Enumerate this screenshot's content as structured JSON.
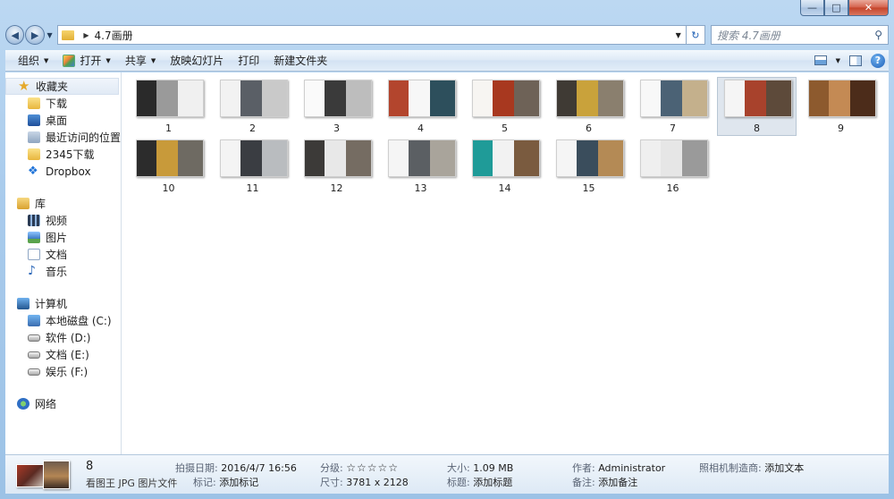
{
  "window": {
    "minimize_glyph": "—",
    "maximize_glyph": "□",
    "close_glyph": "✕"
  },
  "nav": {
    "back_glyph": "◀",
    "forward_glyph": "▶",
    "dropdown_glyph": "▼",
    "address_sep": "▶",
    "address_path": "4.7画册",
    "address_dropdown": "▼",
    "refresh_glyph": "↻",
    "search_placeholder": "搜索 4.7画册",
    "search_glyph": "⚲"
  },
  "toolbar": {
    "organize": "组织",
    "open": "打开",
    "share": "共享",
    "slideshow": "放映幻灯片",
    "print": "打印",
    "new_folder": "新建文件夹",
    "arrow": "▼",
    "help": "?"
  },
  "sidebar": {
    "favorites": {
      "head": "收藏夹",
      "items": [
        "下载",
        "桌面",
        "最近访问的位置",
        "2345下载",
        "Dropbox"
      ]
    },
    "libraries": {
      "head": "库",
      "items": [
        "视频",
        "图片",
        "文档",
        "音乐"
      ]
    },
    "computer": {
      "head": "计算机",
      "items": [
        "本地磁盘 (C:)",
        "软件 (D:)",
        "文档 (E:)",
        "娱乐 (F:)"
      ]
    },
    "network": {
      "head": "网络"
    },
    "icons": {
      "star": "★",
      "dropbox": "❖",
      "music": "♪"
    }
  },
  "files": {
    "items": [
      {
        "name": "1",
        "colors": [
          "#2a2a2a",
          "#9a9a9a",
          "#f0f0f0"
        ]
      },
      {
        "name": "2",
        "colors": [
          "#f2f2f2",
          "#5a5f66",
          "#c9c9c9"
        ]
      },
      {
        "name": "3",
        "colors": [
          "#fafafa",
          "#3a3a3a",
          "#bdbdbd"
        ]
      },
      {
        "name": "4",
        "colors": [
          "#b3452d",
          "#f7f7f7",
          "#2d4f5c"
        ]
      },
      {
        "name": "5",
        "colors": [
          "#f7f5f2",
          "#a8381f",
          "#6e6257"
        ]
      },
      {
        "name": "6",
        "colors": [
          "#3f3a34",
          "#c9a23b",
          "#8a7f6e"
        ]
      },
      {
        "name": "7",
        "colors": [
          "#f8f8f8",
          "#4b6275",
          "#c4b08c"
        ]
      },
      {
        "name": "8",
        "colors": [
          "#f5f5f5",
          "#a8422c",
          "#5d4a3a"
        ]
      },
      {
        "name": "9",
        "colors": [
          "#8d5a2e",
          "#c48a54",
          "#4c2c1a"
        ]
      },
      {
        "name": "10",
        "colors": [
          "#2c2c2c",
          "#c89a3a",
          "#6e6a62"
        ]
      },
      {
        "name": "11",
        "colors": [
          "#f4f4f4",
          "#3a3d42",
          "#b9bcbf"
        ]
      },
      {
        "name": "12",
        "colors": [
          "#3c3a38",
          "#e8e8e8",
          "#756c62"
        ]
      },
      {
        "name": "13",
        "colors": [
          "#f5f5f5",
          "#5b5f63",
          "#a9a49b"
        ]
      },
      {
        "name": "14",
        "colors": [
          "#1f9b98",
          "#f2f2f2",
          "#7a5b3f"
        ]
      },
      {
        "name": "15",
        "colors": [
          "#f5f5f5",
          "#3a4d5c",
          "#b48a55"
        ]
      },
      {
        "name": "16",
        "colors": [
          "#efefef",
          "#e6e6e6",
          "#9a9a9a"
        ]
      }
    ],
    "selected_index": 7
  },
  "details": {
    "name": "8",
    "type": "看图王 JPG 图片文件",
    "date_key": "拍摄日期:",
    "date_val": "2016/4/7 16:56",
    "tag_key": "标记:",
    "tag_val": "添加标记",
    "rating_key": "分级:",
    "rating_val": "☆☆☆☆☆",
    "dims_key": "尺寸:",
    "dims_val": "3781 x 2128",
    "size_key": "大小:",
    "size_val": "1.09 MB",
    "title_key": "标题:",
    "title_val": "添加标题",
    "author_key": "作者:",
    "author_val": "Administrator",
    "comment_key": "备注:",
    "comment_val": "添加备注",
    "maker_key": "照相机制造商:",
    "maker_val": "添加文本"
  }
}
